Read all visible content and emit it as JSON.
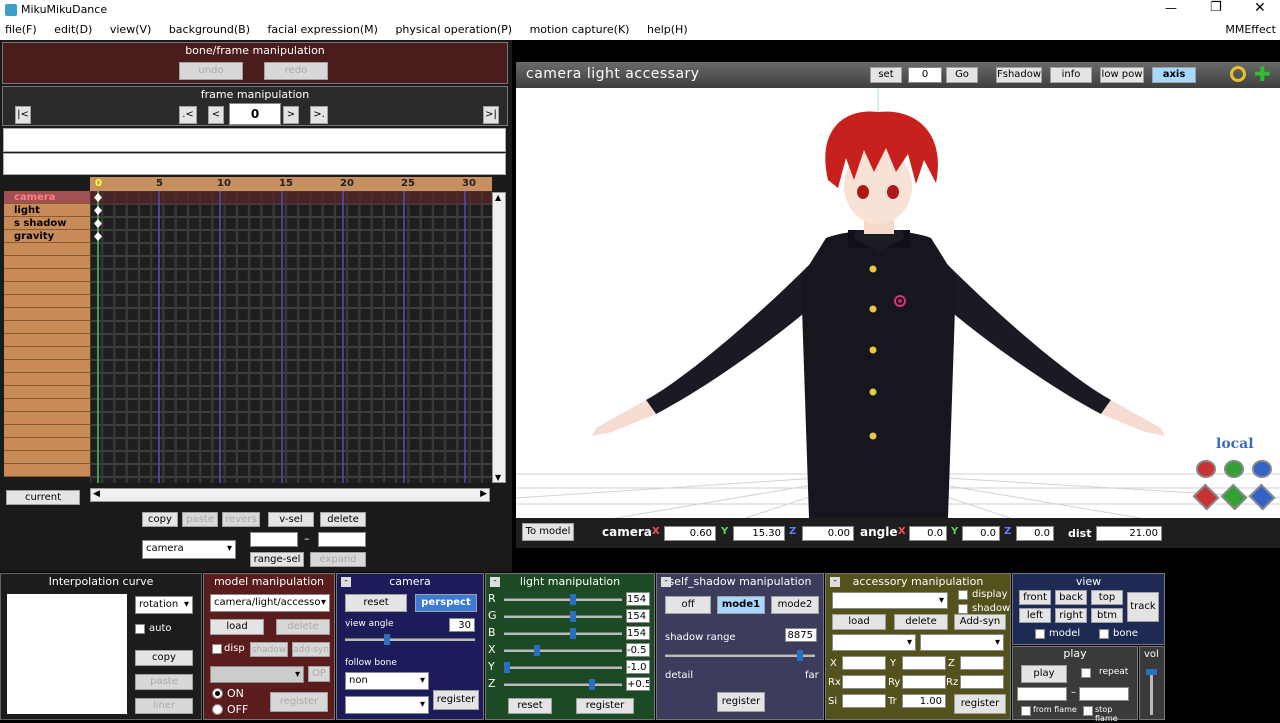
{
  "window": {
    "title": "MikuMikuDance",
    "menu_right": "MMEffect"
  },
  "menu": [
    "file(F)",
    "edit(D)",
    "view(V)",
    "background(B)",
    "facial expression(M)",
    "physical operation(P)",
    "motion capture(K)",
    "help(H)"
  ],
  "bone_frame": {
    "title": "bone/frame manipulation",
    "undo": "undo",
    "redo": "redo"
  },
  "frame_manip": {
    "title": "frame manipulation",
    "frame_value": "0",
    "first": "|<",
    "prev_key": ".<",
    "prev": "<",
    "next": ">",
    "next_key": ">.",
    "last": ">|"
  },
  "timeline": {
    "ticks": [
      "0",
      "5",
      "10",
      "15",
      "20",
      "25",
      "30"
    ],
    "lanes": [
      "camera",
      "light",
      "s shadow",
      "gravity"
    ],
    "current_label": "current"
  },
  "edit_buttons": {
    "copy": "copy",
    "paste": "paste",
    "revers": "revers",
    "vsel": "v-sel",
    "delete": "delete",
    "range_sel": "range-sel",
    "expand": "expand",
    "dash": "–",
    "target": "camera"
  },
  "viewport": {
    "title": "camera light accessary",
    "set": "set",
    "set_value": "0",
    "go": "Go",
    "fshadow": "Fshadow",
    "info": "info",
    "low_pow": "low pow",
    "axis": "axis",
    "local": "local"
  },
  "camera_bar": {
    "to_model": "To model",
    "camera_label": "camera",
    "x_label": "X",
    "y_label": "Y",
    "z_label": "Z",
    "x": "0.60",
    "y": "15.30",
    "z": "0.00",
    "angle_label": "angle",
    "ax": "0.0",
    "ay": "0.0",
    "az": "0.0",
    "dist_label": "dist",
    "dist": "21.00"
  },
  "interp": {
    "title": "Interpolation curve",
    "select": "rotation",
    "auto": "auto",
    "copy": "copy",
    "paste": "paste",
    "liner": "liner"
  },
  "model_manip": {
    "title": "model manipulation",
    "select": "camera/light/accesso",
    "load": "load",
    "delete": "delete",
    "disp": "disp",
    "shadow": "shadow",
    "addsyn": "add-syn",
    "op": "OP",
    "on": "ON",
    "off": "OFF",
    "register": "register"
  },
  "camera_panel": {
    "title": "camera",
    "reset": "reset",
    "perspect": "perspect",
    "view_angle_label": "view angle",
    "view_angle": "30",
    "view_angle_level": 0.3,
    "follow_bone": "follow bone",
    "bone_select": "non",
    "register": "register"
  },
  "light": {
    "title": "light manipulation",
    "rows": [
      {
        "label": "R",
        "value": "154"
      },
      {
        "label": "G",
        "value": "154"
      },
      {
        "label": "B",
        "value": "154"
      },
      {
        "label": "X",
        "value": "-0.5"
      },
      {
        "label": "Y",
        "value": "-1.0"
      },
      {
        "label": "Z",
        "value": "+0.5"
      }
    ],
    "reset": "reset",
    "register": "register"
  },
  "self_shadow": {
    "title": "self_shadow manipulation",
    "off": "off",
    "mode1": "mode1",
    "mode2": "mode2",
    "range_label": "shadow range",
    "range_value": "8875",
    "detail": "detail",
    "far": "far",
    "register": "register"
  },
  "accessory": {
    "title": "accessory manipulation",
    "display": "display",
    "shadow": "shadow",
    "load": "load",
    "delete": "delete",
    "addsyn": "Add-syn",
    "x": "X",
    "y": "Y",
    "z": "Z",
    "rx": "Rx",
    "ry": "Ry",
    "rz": "Rz",
    "si": "Si",
    "tr": "Tr",
    "tr_value": "1.00",
    "register": "register"
  },
  "view": {
    "title": "view",
    "front": "front",
    "back": "back",
    "top": "top",
    "left": "left",
    "right": "right",
    "btm": "btm",
    "track": "track",
    "model": "model",
    "bone": "bone"
  },
  "play": {
    "title": "play",
    "play": "play",
    "repeat": "repeat",
    "dash": "–",
    "from_flame": "from flame",
    "stop_flame": "stop flame",
    "vol": "vol"
  },
  "colors": {
    "model_panel": "#5a1c1c",
    "camera_panel": "#1c1c5a",
    "light_panel": "#1c4a24",
    "shadow_panel": "#3c3c5c",
    "accessory_panel": "#54521c",
    "view_panel": "#1c2a54"
  }
}
